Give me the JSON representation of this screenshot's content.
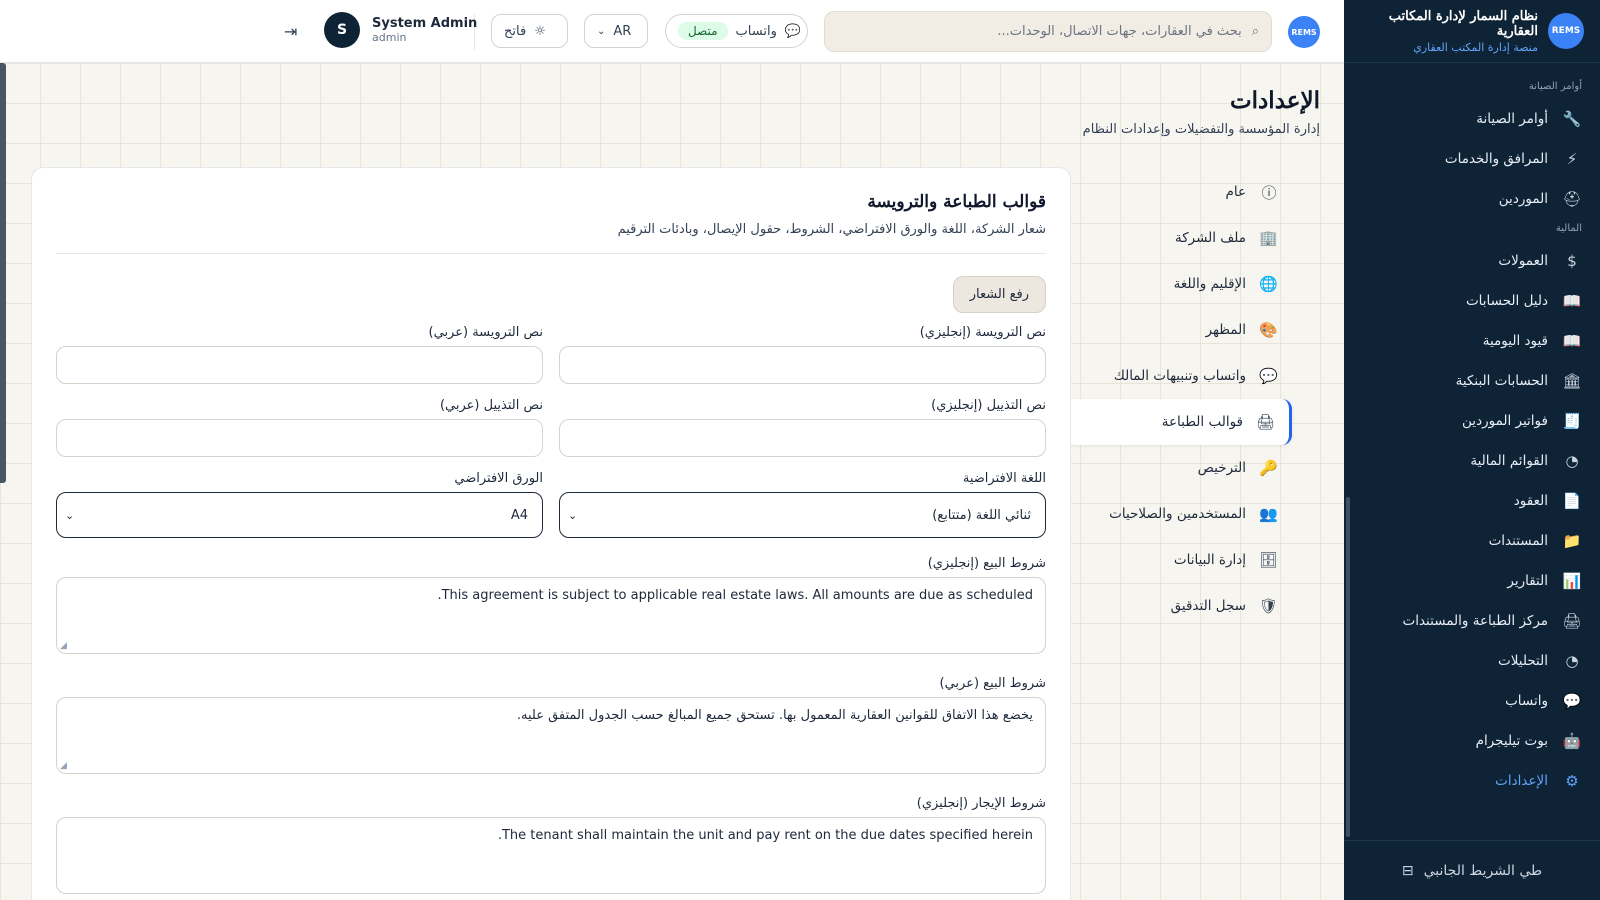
{
  "brand": {
    "logo_text": "REMS",
    "title": "نظام السمار لإدارة المكاتب العقارية",
    "subtitle": "منصة إدارة المكتب العقاري"
  },
  "sidebar": {
    "sections": [
      {
        "title": "أوامر الصيانة",
        "items": [
          {
            "label": "أوامر الصيانة",
            "icon": "wrench-icon",
            "glyph": "🔧"
          },
          {
            "label": "المرافق والخدمات",
            "icon": "bolt-icon",
            "glyph": "⚡"
          },
          {
            "label": "الموردين",
            "icon": "helmet-icon",
            "glyph": "⛑"
          }
        ]
      },
      {
        "title": "المالية",
        "items": [
          {
            "label": "العمولات",
            "icon": "dollar-icon",
            "glyph": "$"
          },
          {
            "label": "دليل الحسابات",
            "icon": "book-icon",
            "glyph": "📖"
          },
          {
            "label": "قيود اليومية",
            "icon": "book-open-icon",
            "glyph": "📖"
          },
          {
            "label": "الحسابات البنكية",
            "icon": "bank-icon",
            "glyph": "🏛"
          },
          {
            "label": "فواتير الموردين",
            "icon": "receipt-icon",
            "glyph": "🧾"
          },
          {
            "label": "القوائم المالية",
            "icon": "pie-chart-icon",
            "glyph": "◔"
          },
          {
            "label": "العقود",
            "icon": "file-icon",
            "glyph": "📄"
          },
          {
            "label": "المستندات",
            "icon": "folder-icon",
            "glyph": "📁"
          },
          {
            "label": "التقارير",
            "icon": "bar-chart-icon",
            "glyph": "📊"
          },
          {
            "label": "مركز الطباعة والمستندات",
            "icon": "printer-icon",
            "glyph": "🖨"
          },
          {
            "label": "التحليلات",
            "icon": "analytics-icon",
            "glyph": "◔"
          },
          {
            "label": "واتساب",
            "icon": "chat-icon",
            "glyph": "💬"
          },
          {
            "label": "بوت تيليجرام",
            "icon": "bot-icon",
            "glyph": "🤖"
          },
          {
            "label": "الإعدادات",
            "icon": "gear-icon",
            "glyph": "⚙",
            "active": true
          }
        ]
      }
    ],
    "collapse_label": "طي الشريط الجانبي"
  },
  "topbar": {
    "search_placeholder": "بحث في العقارات، جهات الاتصال، الوحدات...",
    "whatsapp_label": "واتساب",
    "whatsapp_status": "متصل",
    "language": "AR",
    "theme_label": "فاتح",
    "user": {
      "initial": "S",
      "name": "System Admin",
      "role": "admin"
    }
  },
  "page": {
    "title": "الإعدادات",
    "subtitle": "إدارة المؤسسة والتفضيلات وإعدادات النظام"
  },
  "settings_nav": [
    {
      "label": "عام",
      "icon": "info-icon",
      "glyph": "ⓘ"
    },
    {
      "label": "ملف الشركة",
      "icon": "building-icon",
      "glyph": "🏢"
    },
    {
      "label": "الإقليم واللغة",
      "icon": "globe-icon",
      "glyph": "🌐"
    },
    {
      "label": "المظهر",
      "icon": "palette-icon",
      "glyph": "🎨"
    },
    {
      "label": "واتساب وتنبيهات المالك",
      "icon": "chat-icon",
      "glyph": "💬"
    },
    {
      "label": "قوالب الطباعة",
      "icon": "printer-icon",
      "glyph": "🖨",
      "active": true
    },
    {
      "label": "الترخيص",
      "icon": "key-icon",
      "glyph": "🔑"
    },
    {
      "label": "المستخدمين والصلاحيات",
      "icon": "users-icon",
      "glyph": "👥"
    },
    {
      "label": "إدارة البيانات",
      "icon": "database-icon",
      "glyph": "🗄"
    },
    {
      "label": "سجل التدقيق",
      "icon": "shield-icon",
      "glyph": "🛡"
    }
  ],
  "print_templates": {
    "title": "قوالب الطباعة والترويسة",
    "subtitle": "شعار الشركة، اللغة والورق الافتراضي، الشروط، حقول الإيصال، وبادئات الترقيم",
    "upload_logo": "رفع الشعار",
    "header_en_label": "نص الترويسة (إنجليزي)",
    "header_ar_label": "نص الترويسة (عربي)",
    "footer_en_label": "نص التذييل (إنجليزي)",
    "footer_ar_label": "نص التذييل (عربي)",
    "default_language_label": "اللغة الافتراضية",
    "default_language_value": "ثنائي اللغة (متتابع)",
    "default_paper_label": "الورق الافتراضي",
    "default_paper_value": "A4",
    "sale_terms_en_label": "شروط البيع (إنجليزي)",
    "sale_terms_en_value": "This agreement is subject to applicable real estate laws. All amounts are due as scheduled.",
    "sale_terms_ar_label": "شروط البيع (عربي)",
    "sale_terms_ar_value": "يخضع هذا الاتفاق للقوانين العقارية المعمول بها. تستحق جميع المبالغ حسب الجدول المتفق عليه.",
    "lease_terms_en_label": "شروط الإيجار (إنجليزي)",
    "lease_terms_en_value": "The tenant shall maintain the unit and pay rent on the due dates specified herein."
  }
}
